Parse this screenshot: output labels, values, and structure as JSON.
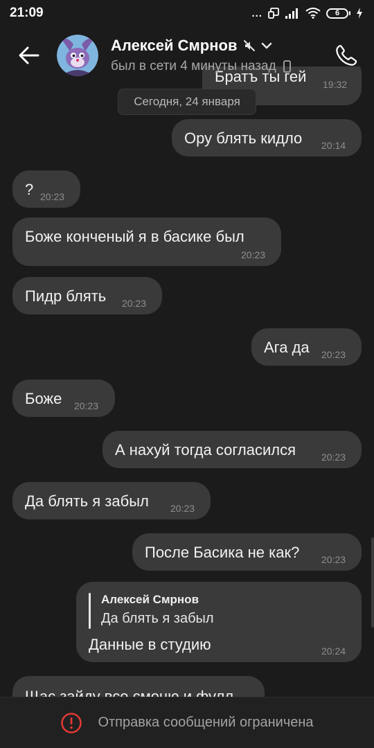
{
  "status_bar": {
    "time": "21:09",
    "dots": "...",
    "battery_level": "6",
    "icons": [
      "screen-cast-icon",
      "signal-icon",
      "wifi-icon",
      "battery-icon",
      "charging-icon"
    ]
  },
  "header": {
    "contact_name": "Алексей Смрнов",
    "last_seen": "был в сети 4 минуты назад",
    "icons": [
      "back-arrow-icon",
      "muted-icon",
      "chevron-down-icon",
      "phone-device-icon",
      "call-icon"
    ]
  },
  "chat": {
    "date_separator": "Сегодня, 24 января",
    "messages": [
      {
        "direction": "outgoing",
        "text": "Братъ ты гей",
        "time": "19:32",
        "partial": true
      },
      {
        "direction": "outgoing",
        "text": "Ору блять кидло",
        "time": "20:14"
      },
      {
        "direction": "incoming",
        "text": "?",
        "time": "20:23"
      },
      {
        "direction": "incoming",
        "text": "Боже конченый я в басике был",
        "time": "20:23"
      },
      {
        "direction": "incoming",
        "text": "Пидр блять",
        "time": "20:23"
      },
      {
        "direction": "outgoing",
        "text": "Ага да",
        "time": "20:23"
      },
      {
        "direction": "incoming",
        "text": "Боже",
        "time": "20:23"
      },
      {
        "direction": "outgoing",
        "text": "А нахуй тогда согласился",
        "time": "20:23"
      },
      {
        "direction": "incoming",
        "text": "Да блять я забыл",
        "time": "20:23"
      },
      {
        "direction": "outgoing",
        "text": "После Басика не как?",
        "time": "20:23"
      },
      {
        "direction": "outgoing",
        "reply_author": "Алексей Смрнов",
        "reply_text": "Да блять я забыл",
        "text": "Данные в студию",
        "time": "20:24"
      },
      {
        "direction": "incoming",
        "text": "Щас зайду все сменю и фулл",
        "time": "",
        "partial": true
      }
    ]
  },
  "bottom_bar": {
    "text": "Отправка сообщений ограничена",
    "icon": "alert-circle-icon"
  },
  "colors": {
    "background": "#1b1b1b",
    "bubble": "#3a3a3a",
    "alert": "#e53935"
  }
}
